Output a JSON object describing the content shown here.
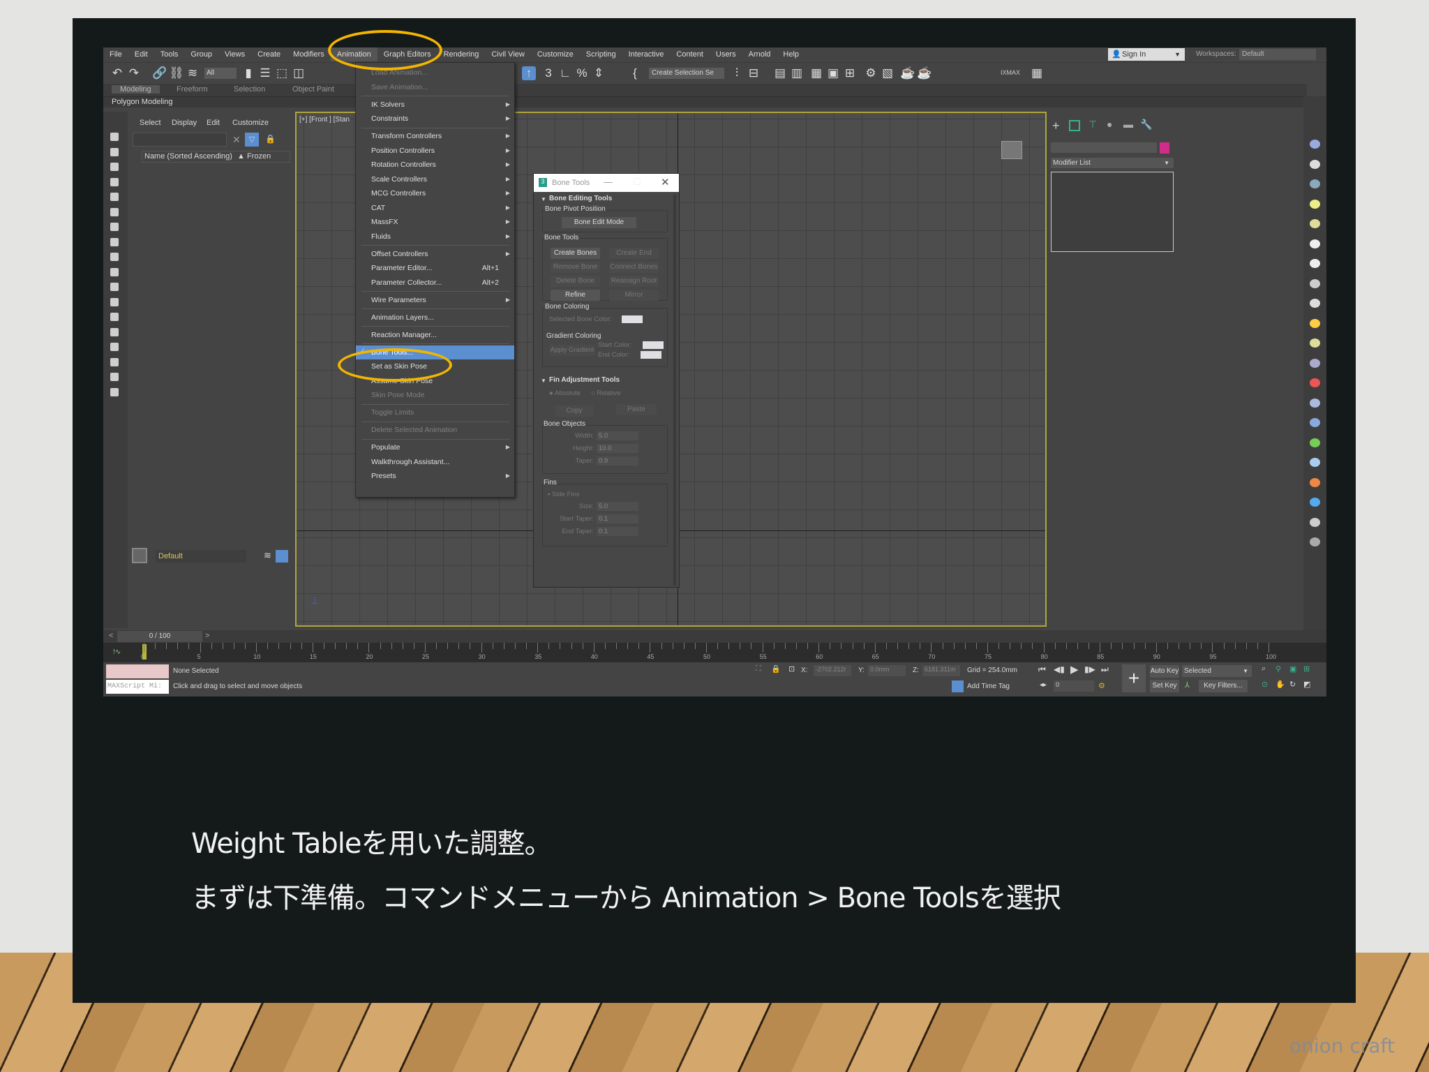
{
  "menubar": [
    "File",
    "Edit",
    "Tools",
    "Group",
    "Views",
    "Create",
    "Modifiers",
    "Animation",
    "Graph Editors",
    "Rendering",
    "Civil View",
    "Customize",
    "Scripting",
    "Interactive",
    "Content",
    "Users",
    "Arnold",
    "Help"
  ],
  "account": {
    "sign_in": "Sign In",
    "workspaces_label": "Workspaces:",
    "workspace": "Default"
  },
  "toolbar": {
    "filter": "All",
    "selection_set": "Create Selection Se",
    "ixmax": "IXMAX"
  },
  "ribbon": {
    "tabs": [
      "Modeling",
      "Freeform",
      "Selection",
      "Object Paint"
    ],
    "sub": "Polygon Modeling"
  },
  "explorer": {
    "menus": [
      "Select",
      "Display",
      "Edit",
      "Customize"
    ],
    "column": "Name (Sorted Ascending)",
    "frozen": "▲ Frozen",
    "layer": "Default"
  },
  "viewport": {
    "label": "[+] [Front ] [Stan"
  },
  "animation_menu": [
    {
      "label": "Load Animation...",
      "disabled": true
    },
    {
      "label": "Save Animation...",
      "disabled": true
    },
    {
      "label": "IK Solvers",
      "sub": true
    },
    {
      "label": "Constraints",
      "sub": true
    },
    {
      "label": "Transform Controllers",
      "sub": true
    },
    {
      "label": "Position Controllers",
      "sub": true
    },
    {
      "label": "Rotation Controllers",
      "sub": true
    },
    {
      "label": "Scale Controllers",
      "sub": true
    },
    {
      "label": "MCG Controllers",
      "sub": true
    },
    {
      "label": "CAT",
      "sub": true
    },
    {
      "label": "MassFX",
      "sub": true
    },
    {
      "label": "Fluids",
      "sub": true
    },
    {
      "label": "Offset Controllers",
      "sub": true
    },
    {
      "label": "Parameter Editor...",
      "shortcut": "Alt+1"
    },
    {
      "label": "Parameter Collector...",
      "shortcut": "Alt+2"
    },
    {
      "label": "Wire Parameters",
      "sub": true
    },
    {
      "label": "Animation Layers..."
    },
    {
      "label": "Reaction Manager..."
    },
    {
      "label": "Bone Tools...",
      "highlighted": true
    },
    {
      "label": "Set as Skin Pose"
    },
    {
      "label": "Assume Skin Pose"
    },
    {
      "label": "Skin Pose Mode",
      "disabled": true
    },
    {
      "label": "Toggle Limits",
      "disabled": true
    },
    {
      "label": "Delete Selected Animation",
      "disabled": true
    },
    {
      "label": "Populate",
      "sub": true
    },
    {
      "label": "Walkthrough Assistant..."
    },
    {
      "label": "Presets",
      "sub": true
    }
  ],
  "bone_tools": {
    "title": "Bone Tools",
    "editing": "Bone Editing Tools",
    "pivot": "Bone Pivot Position",
    "edit_mode": "Bone Edit Mode",
    "tools": "Bone Tools",
    "create_bones": "Create Bones",
    "create_end": "Create End",
    "remove_bone": "Remove Bone",
    "connect_bones": "Connect Bones",
    "delete_bone": "Delete Bone",
    "reassign_root": "Reassign Root",
    "refine": "Refine",
    "mirror": "Mirror",
    "coloring": "Bone Coloring",
    "selected_color": "Selected Bone Color:",
    "gradient": "Gradient Coloring",
    "apply_gradient": "Apply Gradient",
    "start_color": "Start Color:",
    "end_color": "End Color:",
    "fin": "Fin Adjustment Tools",
    "absolute": "Absolute",
    "relative": "Relative",
    "copy": "Copy",
    "paste": "Paste",
    "objects": "Bone Objects",
    "width_l": "Width:",
    "width": "5.0",
    "height_l": "Height:",
    "height": "10.0",
    "taper_l": "Taper:",
    "taper": "0.9",
    "fins": "Fins",
    "side_fins": "Side Fins",
    "size_l": "Size:",
    "size": "5.0",
    "start_taper_l": "Start Taper:",
    "start_taper": "0.1",
    "end_taper_l": "End Taper:",
    "end_taper": "0.1"
  },
  "command_panel": {
    "modifier_list": "Modifier List",
    "color": "#d02c8a"
  },
  "timeline": {
    "frame": "0 / 100",
    "labels": [
      "0",
      "5",
      "10",
      "15",
      "20",
      "25",
      "30",
      "35",
      "40",
      "45",
      "50",
      "55",
      "60",
      "65",
      "70",
      "75",
      "80",
      "85",
      "90",
      "95",
      "100"
    ]
  },
  "status": {
    "selection": "None Selected",
    "prompt": "Click and drag to select and move objects",
    "maxscript": "MAXScript Mi:",
    "x_l": "X:",
    "x": "-2702.212r",
    "y_l": "Y:",
    "y": "0.0mm",
    "z_l": "Z:",
    "z": "6181.311m",
    "grid": "Grid = 254.0mm",
    "add_time_tag": "Add Time Tag",
    "frame": "0",
    "auto_key": "Auto Key",
    "set_key": "Set Key",
    "key_mode": "Selected",
    "key_filters": "Key Filters..."
  },
  "caption": {
    "line1": "Weight Tableを用いた調整。",
    "line2": "まずは下準備。コマンドメニューから Animation > Bone Toolsを選択"
  },
  "watermark": "onion craft",
  "colors": {
    "highlight": "#5b8fd0",
    "annotation": "#f2b500",
    "slide": "#141a1a"
  }
}
